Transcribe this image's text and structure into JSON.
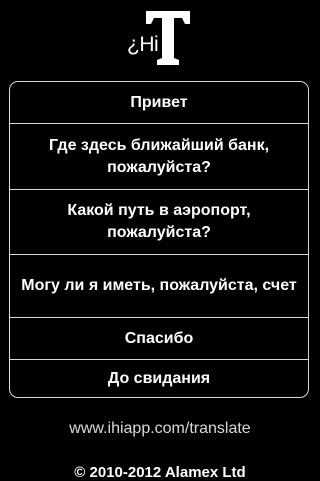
{
  "app": {
    "logo_text": "¿Hi",
    "logo_letter": "T"
  },
  "phrases": [
    "Привет",
    "Где здесь ближайший банк, пожалуйста?",
    "Какой путь в аэропорт, пожалуйста?",
    "Могу ли я иметь, пожалуйста, счет",
    "Спасибо",
    "До свидания"
  ],
  "footer": {
    "link": "www.ihiapp.com/translate",
    "copyright": "© 2010-2012 Alamex Ltd"
  },
  "colors": {
    "background": "#000000",
    "text": "#ffffff",
    "border": "#d8d8d8",
    "link": "#d9d9d9"
  }
}
